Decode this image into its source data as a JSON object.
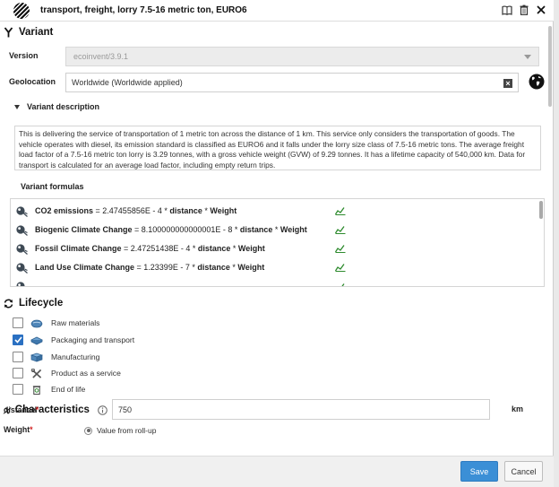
{
  "dialog": {
    "title": "transport, freight, lorry 7.5-16 metric ton, EURO6",
    "icons": [
      "book-icon",
      "trash-icon",
      "close-icon"
    ]
  },
  "variant": {
    "section_title": "Variant",
    "version_label": "Version",
    "version_value": "ecoinvent/3.9.1",
    "geolocation_label": "Geolocation",
    "geolocation_value": "Worldwide (Worldwide applied)",
    "description_toggle": "Variant description",
    "description": "This is delivering the service of transportation of 1 metric ton across the distance of 1 km. This service only considers the transportation of goods. The vehicle operates with diesel, its emission standard is classified as EURO6 and it falls under the lorry size class of 7.5-16 metric tons. The average freight load factor of a 7.5-16 metric ton lorry is 3.29 tonnes, with a gross vehicle weight (GVW) of 9.29 tonnes. It has a lifetime capacity of 540,000 km. Data for transport is calculated for an average load factor, including empty return trips.",
    "formulas_title": "Variant formulas",
    "formulas": [
      {
        "name": "CO2 emissions",
        "expr": " = 2.47455856E - 4 * ",
        "var1": "distance",
        "op": " * ",
        "var2": "Weight"
      },
      {
        "name": "Biogenic Climate Change",
        "expr": " = 8.100000000000001E - 8 * ",
        "var1": "distance",
        "op": " * ",
        "var2": "Weight"
      },
      {
        "name": "Fossil Climate Change",
        "expr": " = 2.47251438E - 4 * ",
        "var1": "distance",
        "op": " * ",
        "var2": "Weight"
      },
      {
        "name": "Land Use Climate Change",
        "expr": " = 1.23399E - 7 * ",
        "var1": "distance",
        "op": " * ",
        "var2": "Weight"
      }
    ]
  },
  "lifecycle": {
    "section_title": "Lifecycle",
    "items": [
      {
        "label": "Raw materials",
        "checked": false
      },
      {
        "label": "Packaging and transport",
        "checked": true
      },
      {
        "label": "Manufacturing",
        "checked": false
      },
      {
        "label": "Product as a service",
        "checked": false
      },
      {
        "label": "End of life",
        "checked": false
      }
    ]
  },
  "characteristics": {
    "section_title": "Characteristics",
    "distance_label": "distance",
    "required_mark": "*",
    "distance_value": "750",
    "distance_unit": "km",
    "weight_label": "Weight",
    "weight_option": "Value from roll-up"
  },
  "footer": {
    "save_label": "Save",
    "cancel_label": "Cancel"
  },
  "colors": {
    "accent": "#3b8fd6",
    "checkbox_checked": "#2a70c2",
    "trend_icon": "#2e8b2e",
    "required": "#d02020"
  }
}
